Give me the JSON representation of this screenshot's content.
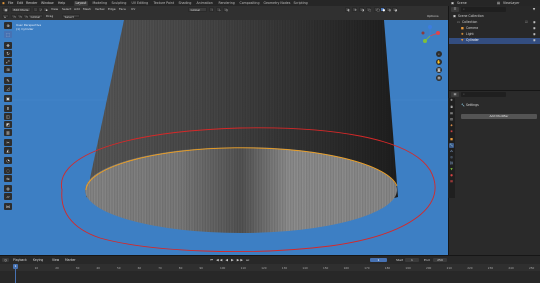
{
  "topbar": {
    "menus": [
      "File",
      "Edit",
      "Render",
      "Window",
      "Help"
    ],
    "workspaces": [
      "Layout",
      "Modeling",
      "Sculpting",
      "UV Editing",
      "Texture Paint",
      "Shading",
      "Animation",
      "Rendering",
      "Compositing",
      "Geometry Nodes",
      "Scripting"
    ],
    "active_workspace": "Layout",
    "scene_label": "Scene",
    "view_layer_label": "ViewLayer"
  },
  "viewport_header": {
    "mode": "Edit Mode",
    "view_menus": [
      "View",
      "Select",
      "Add",
      "Mesh",
      "Vertex",
      "Edge",
      "Face",
      "UV"
    ],
    "transform": "Global",
    "options": "Options",
    "sub_row": {
      "transform_label": "Global",
      "snap_label": "Drag",
      "select_box": "Select Box"
    }
  },
  "overlay_text": {
    "line1": "User Perspective",
    "line2": "(1) Cylinder"
  },
  "toolbar": {
    "tools": [
      "cursor",
      "select",
      "move",
      "rotate",
      "scale",
      "transform",
      "annotate",
      "measure",
      "add-cube",
      "extrude",
      "inset",
      "bevel",
      "loop-cut",
      "knife",
      "poly-build",
      "spin",
      "smooth",
      "edge-slide",
      "shrink",
      "shear",
      "rip"
    ]
  },
  "outliner": {
    "title": "Scene Collection",
    "items": [
      {
        "label": "Collection",
        "icon": "collection-icon"
      },
      {
        "label": "Camera",
        "icon": "camera-icon"
      },
      {
        "label": "Light",
        "icon": "light-icon"
      },
      {
        "label": "Cylinder",
        "icon": "mesh-icon",
        "selected": true
      }
    ]
  },
  "properties": {
    "panel_title": "Settings",
    "button_label": "Add Modifier",
    "tabs": [
      "tool",
      "render",
      "output",
      "view-layer",
      "scene",
      "world",
      "object",
      "modifiers",
      "particles",
      "physics",
      "constraints",
      "data",
      "material",
      "texture"
    ]
  },
  "timeline": {
    "menus": [
      "Playback",
      "Keying",
      "View",
      "Marker"
    ],
    "current_frame": "1",
    "start_label": "Start",
    "start_value": "1",
    "end_label": "End",
    "end_value": "250",
    "ticks": [
      "0",
      "10",
      "20",
      "30",
      "40",
      "50",
      "60",
      "70",
      "80",
      "90",
      "100",
      "110",
      "120",
      "130",
      "140",
      "150",
      "160",
      "170",
      "180",
      "190",
      "200",
      "210",
      "220",
      "230",
      "240",
      "250"
    ]
  },
  "colors": {
    "viewport_bg": "#3d7fc4",
    "selection_edge": "#f0a020",
    "annotation": "#d62828",
    "accent": "#4772b3"
  }
}
